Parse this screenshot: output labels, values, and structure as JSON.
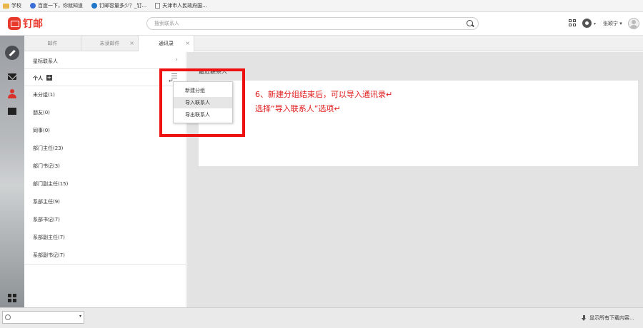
{
  "bookmarks": [
    {
      "icon": "folder-icon",
      "label": "学校"
    },
    {
      "icon": "baidu-paw-icon",
      "label": "百度一下，你就知道"
    },
    {
      "icon": "dingmail-icon",
      "label": "钉邮容量多少？_钉..."
    },
    {
      "icon": "page-icon",
      "label": "天津市人民政府国..."
    }
  ],
  "header": {
    "logo_text": "钉邮",
    "search_placeholder": "搜索联系人",
    "user_name": "张颖宁",
    "caret": "▾"
  },
  "tabs": [
    {
      "label": "邮件",
      "active": false,
      "closable": false
    },
    {
      "label": "未读邮件",
      "active": false,
      "closable": true
    },
    {
      "label": "通讯录",
      "active": true,
      "closable": true
    }
  ],
  "tab_close_glyph": "×",
  "contacts": {
    "starred_label": "星标联系人",
    "chevron": "›",
    "personal_label": "个人",
    "groups": [
      "未分组(1)",
      "朋友(0)",
      "同事(0)",
      "部门主任(23)",
      "部门书记(3)",
      "部门副主任(15)",
      "系部主任(9)",
      "系部书记(7)",
      "系部副主任(7)",
      "系部副书记(7)"
    ]
  },
  "group_menu": {
    "items": [
      "新建分组",
      "导入联系人",
      "导出联系人"
    ],
    "highlighted": "导入联系人"
  },
  "return_glyph": "↵",
  "right_panel": {
    "recent_label": "最近联系人"
  },
  "annotation": {
    "line1": "6、新建分组结束后，可以导入通讯录↵",
    "line2": "选择“导入联系人”选项↵",
    "color": "#e01818"
  },
  "status_bar": {
    "downloads_text": "显示所有下载内容..."
  },
  "colors": {
    "brand": "#e8382b",
    "annotation_box": "#ee1111"
  }
}
